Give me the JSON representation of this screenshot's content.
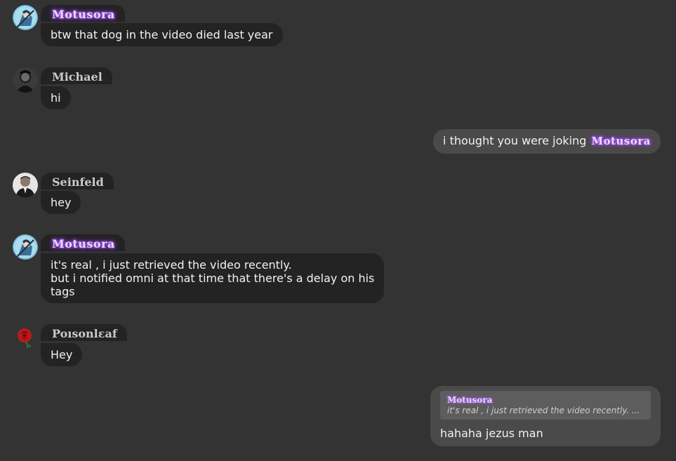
{
  "colors": {
    "background": "#333333",
    "incoming_bubble": "#232323",
    "outgoing_bubble": "#4a4a4a",
    "reply_box": "#5d5d5d",
    "glow_name": "#a24dff",
    "plain_name": "#c9c9c9"
  },
  "messages": [
    {
      "author": "Motusora",
      "avatar_icon": "anime-character-avatar",
      "lines": [
        "btw that dog in the video died last year"
      ]
    },
    {
      "author": "Michael",
      "avatar_icon": "dark-portrait-avatar",
      "lines": [
        "hi"
      ]
    },
    {
      "self": true,
      "text": "i thought you were joking",
      "mention": "Motusora"
    },
    {
      "author": "Seinfeld",
      "avatar_icon": "man-in-suit-avatar",
      "lines": [
        "hey"
      ]
    },
    {
      "author": "Motusora",
      "avatar_icon": "anime-character-avatar",
      "lines": [
        "it's real , i just retrieved the video recently.",
        "but i notified omni at that time that there's a delay on his",
        "tags"
      ]
    },
    {
      "author": "Poisonleaf",
      "author_display": "Poısonlɛaf",
      "avatar_icon": "red-rose-avatar",
      "lines": [
        "Hey"
      ]
    },
    {
      "self": true,
      "reply_to": {
        "author": "Motusora",
        "text": "it's real , i just retrieved the video recently. ..."
      },
      "text": "hahaha jezus man"
    }
  ]
}
